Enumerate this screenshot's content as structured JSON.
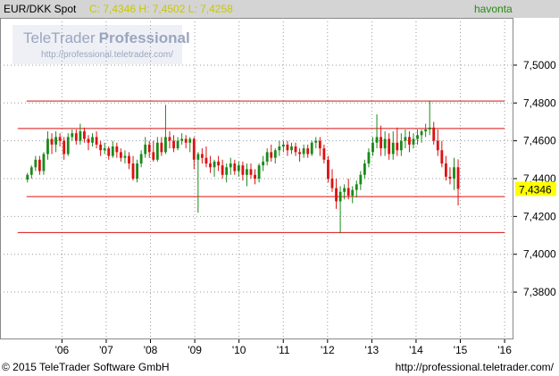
{
  "header": {
    "symbol": "EUR/DKK Spot",
    "ohlc": "C: 7,4346 H: 7,4502 L: 7,4258",
    "period": "havonta"
  },
  "watermark": {
    "brand_plain": "TeleTrader",
    "brand_bold": "Professional",
    "url": "http://professional.teletrader.com/"
  },
  "footer": {
    "copyright": "© 2015 TeleTrader Software GmbH",
    "url": "http://professional.teletrader.com/"
  },
  "colors": {
    "up": "#1a8a1a",
    "down": "#dd1111",
    "level_line": "#dd1111",
    "grid": "#999999",
    "last_price_badge": "#ffff00",
    "header_bg": "#d4d4d4"
  },
  "chart_data": {
    "type": "candlestick",
    "interval": "monthly",
    "ylim": [
      7.355,
      7.525
    ],
    "y_ticks": [
      "7,3800",
      "7,4000",
      "7,4200",
      "7,4400",
      "7,4600",
      "7,4800",
      "7,5000"
    ],
    "y_tick_values": [
      7.38,
      7.4,
      7.42,
      7.44,
      7.46,
      7.48,
      7.5
    ],
    "x_ticks": [
      "'06",
      "'07",
      "'08",
      "'09",
      "'10",
      "'11",
      "'12",
      "'13",
      "'14",
      "'15",
      "'16"
    ],
    "x_tick_years": [
      2006,
      2007,
      2008,
      2009,
      2010,
      2011,
      2012,
      2013,
      2014,
      2015,
      2016
    ],
    "x_range_years": [
      2004.6,
      2016.2
    ],
    "last_price_label": "7,4346",
    "last_price": 7.4346,
    "horizontal_levels": [
      {
        "value": 7.481,
        "from": 2005.2,
        "to": 2016.0
      },
      {
        "value": 7.4665,
        "from": 2005.0,
        "to": 2016.0
      },
      {
        "value": 7.4305,
        "from": 2005.2,
        "to": 2016.0
      },
      {
        "value": 7.4115,
        "from": 2005.0,
        "to": 2016.0
      }
    ],
    "candles_ohlc": [
      [
        7.4395,
        7.443,
        7.438,
        7.442
      ],
      [
        7.442,
        7.447,
        7.44,
        7.446
      ],
      [
        7.446,
        7.452,
        7.444,
        7.45
      ],
      [
        7.45,
        7.452,
        7.442,
        7.444
      ],
      [
        7.444,
        7.454,
        7.442,
        7.453
      ],
      [
        7.453,
        7.465,
        7.45,
        7.461
      ],
      [
        7.461,
        7.464,
        7.453,
        7.458
      ],
      [
        7.458,
        7.465,
        7.454,
        7.462
      ],
      [
        7.462,
        7.464,
        7.457,
        7.46
      ],
      [
        7.46,
        7.462,
        7.45,
        7.453
      ],
      [
        7.453,
        7.464,
        7.452,
        7.462
      ],
      [
        7.462,
        7.466,
        7.46,
        7.464
      ],
      [
        7.464,
        7.466,
        7.458,
        7.46
      ],
      [
        7.46,
        7.469,
        7.458,
        7.465
      ],
      [
        7.465,
        7.467,
        7.459,
        7.461
      ],
      [
        7.461,
        7.463,
        7.455,
        7.459
      ],
      [
        7.459,
        7.464,
        7.457,
        7.462
      ],
      [
        7.462,
        7.465,
        7.456,
        7.458
      ],
      [
        7.458,
        7.46,
        7.452,
        7.455
      ],
      [
        7.455,
        7.459,
        7.453,
        7.456
      ],
      [
        7.456,
        7.457,
        7.45,
        7.452
      ],
      [
        7.452,
        7.46,
        7.451,
        7.457
      ],
      [
        7.457,
        7.459,
        7.451,
        7.454
      ],
      [
        7.454,
        7.456,
        7.449,
        7.451
      ],
      [
        7.451,
        7.455,
        7.448,
        7.452
      ],
      [
        7.452,
        7.454,
        7.445,
        7.448
      ],
      [
        7.448,
        7.452,
        7.439,
        7.44
      ],
      [
        7.44,
        7.45,
        7.438,
        7.448
      ],
      [
        7.448,
        7.455,
        7.446,
        7.453
      ],
      [
        7.453,
        7.462,
        7.451,
        7.458
      ],
      [
        7.458,
        7.46,
        7.451,
        7.454
      ],
      [
        7.454,
        7.46,
        7.449,
        7.45
      ],
      [
        7.45,
        7.462,
        7.449,
        7.459
      ],
      [
        7.459,
        7.462,
        7.452,
        7.454
      ],
      [
        7.454,
        7.479,
        7.453,
        7.462
      ],
      [
        7.462,
        7.465,
        7.456,
        7.46
      ],
      [
        7.46,
        7.463,
        7.454,
        7.456
      ],
      [
        7.456,
        7.462,
        7.455,
        7.46
      ],
      [
        7.46,
        7.464,
        7.458,
        7.461
      ],
      [
        7.461,
        7.463,
        7.456,
        7.459
      ],
      [
        7.459,
        7.462,
        7.454,
        7.461
      ],
      [
        7.461,
        7.462,
        7.445,
        7.45
      ],
      [
        7.45,
        7.454,
        7.422,
        7.453
      ],
      [
        7.453,
        7.456,
        7.448,
        7.451
      ],
      [
        7.451,
        7.457,
        7.446,
        7.448
      ],
      [
        7.448,
        7.452,
        7.443,
        7.446
      ],
      [
        7.446,
        7.45,
        7.441,
        7.449
      ],
      [
        7.449,
        7.452,
        7.444,
        7.447
      ],
      [
        7.447,
        7.45,
        7.44,
        7.442
      ],
      [
        7.442,
        7.448,
        7.438,
        7.446
      ],
      [
        7.446,
        7.451,
        7.442,
        7.448
      ],
      [
        7.448,
        7.45,
        7.442,
        7.444
      ],
      [
        7.444,
        7.449,
        7.441,
        7.447
      ],
      [
        7.447,
        7.449,
        7.439,
        7.442
      ],
      [
        7.442,
        7.448,
        7.436,
        7.445
      ],
      [
        7.445,
        7.448,
        7.44,
        7.442
      ],
      [
        7.442,
        7.445,
        7.437,
        7.44
      ],
      [
        7.44,
        7.448,
        7.438,
        7.447
      ],
      [
        7.447,
        7.452,
        7.444,
        7.449
      ],
      [
        7.449,
        7.456,
        7.447,
        7.454
      ],
      [
        7.454,
        7.458,
        7.449,
        7.451
      ],
      [
        7.451,
        7.456,
        7.448,
        7.455
      ],
      [
        7.455,
        7.46,
        7.452,
        7.457
      ],
      [
        7.457,
        7.46,
        7.454,
        7.458
      ],
      [
        7.458,
        7.46,
        7.452,
        7.455
      ],
      [
        7.455,
        7.459,
        7.453,
        7.457
      ],
      [
        7.457,
        7.459,
        7.452,
        7.454
      ],
      [
        7.454,
        7.456,
        7.449,
        7.453
      ],
      [
        7.453,
        7.458,
        7.451,
        7.456
      ],
      [
        7.456,
        7.458,
        7.451,
        7.453
      ],
      [
        7.453,
        7.46,
        7.452,
        7.459
      ],
      [
        7.459,
        7.462,
        7.456,
        7.46
      ],
      [
        7.46,
        7.462,
        7.452,
        7.456
      ],
      [
        7.456,
        7.458,
        7.448,
        7.45
      ],
      [
        7.45,
        7.452,
        7.438,
        7.44
      ],
      [
        7.44,
        7.445,
        7.433,
        7.435
      ],
      [
        7.435,
        7.44,
        7.424,
        7.428
      ],
      [
        7.428,
        7.436,
        7.411,
        7.433
      ],
      [
        7.433,
        7.437,
        7.429,
        7.435
      ],
      [
        7.435,
        7.44,
        7.429,
        7.431
      ],
      [
        7.431,
        7.436,
        7.427,
        7.434
      ],
      [
        7.434,
        7.439,
        7.43,
        7.437
      ],
      [
        7.437,
        7.444,
        7.434,
        7.442
      ],
      [
        7.442,
        7.45,
        7.44,
        7.448
      ],
      [
        7.448,
        7.456,
        7.446,
        7.454
      ],
      [
        7.454,
        7.462,
        7.452,
        7.459
      ],
      [
        7.459,
        7.474,
        7.456,
        7.462
      ],
      [
        7.462,
        7.468,
        7.452,
        7.456
      ],
      [
        7.456,
        7.465,
        7.452,
        7.461
      ],
      [
        7.461,
        7.464,
        7.45,
        7.453
      ],
      [
        7.453,
        7.465,
        7.45,
        7.459
      ],
      [
        7.459,
        7.467,
        7.452,
        7.455
      ],
      [
        7.455,
        7.464,
        7.452,
        7.46
      ],
      [
        7.46,
        7.466,
        7.456,
        7.462
      ],
      [
        7.462,
        7.465,
        7.454,
        7.458
      ],
      [
        7.458,
        7.464,
        7.456,
        7.461
      ],
      [
        7.461,
        7.466,
        7.458,
        7.463
      ],
      [
        7.463,
        7.466,
        7.459,
        7.465
      ],
      [
        7.465,
        7.469,
        7.462,
        7.466
      ],
      [
        7.466,
        7.481,
        7.463,
        7.467
      ],
      [
        7.467,
        7.47,
        7.458,
        7.46
      ],
      [
        7.46,
        7.466,
        7.452,
        7.455
      ],
      [
        7.455,
        7.46,
        7.446,
        7.448
      ],
      [
        7.448,
        7.452,
        7.439,
        7.441
      ],
      [
        7.441,
        7.446,
        7.437,
        7.44
      ],
      [
        7.44,
        7.451,
        7.434,
        7.446
      ],
      [
        7.446,
        7.4502,
        7.4258,
        7.4346
      ]
    ]
  }
}
